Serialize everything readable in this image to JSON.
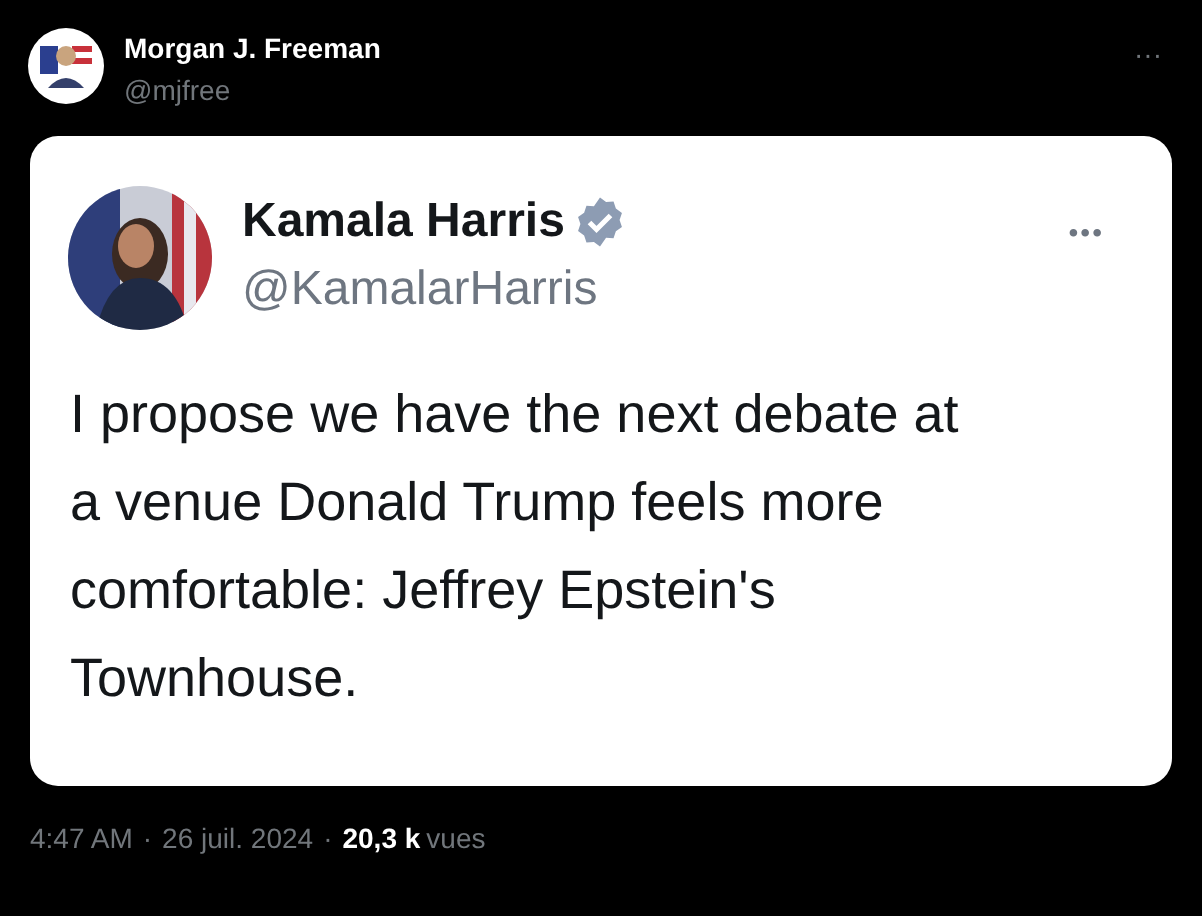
{
  "post": {
    "author": "Morgan J. Freeman",
    "handle": "@mjfree",
    "more": "···"
  },
  "embedded_tweet": {
    "author": "Kamala Harris",
    "verified": true,
    "handle": "@KamalarHarris",
    "more": "•••",
    "text_lines": [
      "I propose we have the next debate at",
      "a venue Donald Trump feels more",
      "comfortable: Jeffrey Epstein's",
      "Townhouse."
    ]
  },
  "footer": {
    "time": "4:47 AM",
    "separator": "·",
    "date": "26 juil. 2024",
    "separator_2": "·",
    "views_count": "20,3 k",
    "views_label": "vues"
  }
}
